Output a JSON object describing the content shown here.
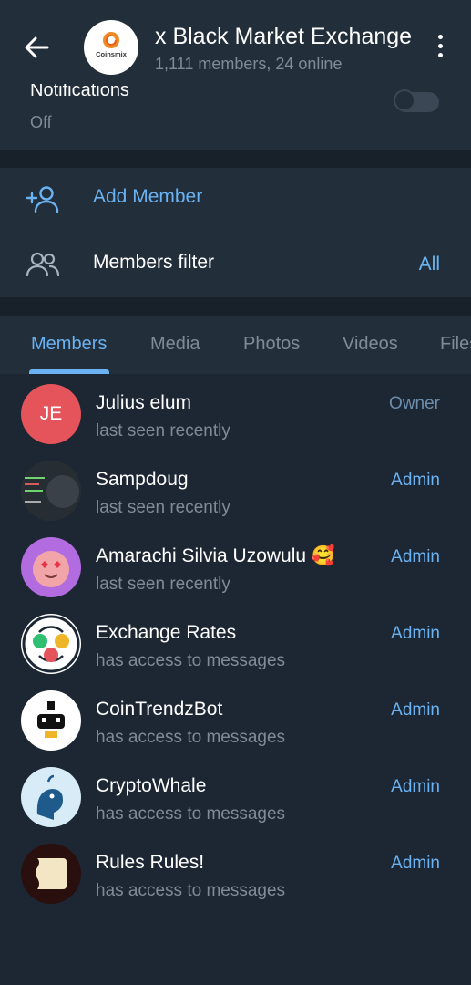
{
  "header": {
    "title": "x Black Market Exchange",
    "subtitle": "1,111 members, 24 online",
    "avatar_text": "Coinsmix"
  },
  "notifications": {
    "label": "Notifications",
    "value": "Off",
    "enabled": false
  },
  "actions": {
    "add_member": "Add Member",
    "members_filter": "Members filter",
    "members_filter_value": "All"
  },
  "tabs": {
    "items": [
      "Members",
      "Media",
      "Photos",
      "Videos",
      "Files"
    ],
    "active": "Members"
  },
  "members": [
    {
      "name": "Julius elum",
      "status": "last seen recently",
      "role": "Owner",
      "initials": "JE",
      "avatar_color": "#e5545a"
    },
    {
      "name": "Sampdoug",
      "status": "last seen recently",
      "role": "Admin",
      "avatar_color": "#2c343c"
    },
    {
      "name": "Amarachi Silvia Uzowulu 🥰",
      "status": "last seen recently",
      "role": "Admin",
      "avatar_color": "#b36be0"
    },
    {
      "name": "Exchange Rates",
      "status": "has access to messages",
      "role": "Admin",
      "avatar_color": "#ffffff"
    },
    {
      "name": "CoinTrendzBot",
      "status": "has access to messages",
      "role": "Admin",
      "avatar_color": "#ffffff"
    },
    {
      "name": "CryptoWhale",
      "status": "has access to messages",
      "role": "Admin",
      "avatar_color": "#d8ecf7"
    },
    {
      "name": "Rules Rules!",
      "status": "has access to messages",
      "role": "Admin",
      "avatar_color": "#2a0f0f"
    }
  ],
  "colors": {
    "accent": "#6ab2f2",
    "background": "#1d2733",
    "surface": "#222e3a"
  }
}
